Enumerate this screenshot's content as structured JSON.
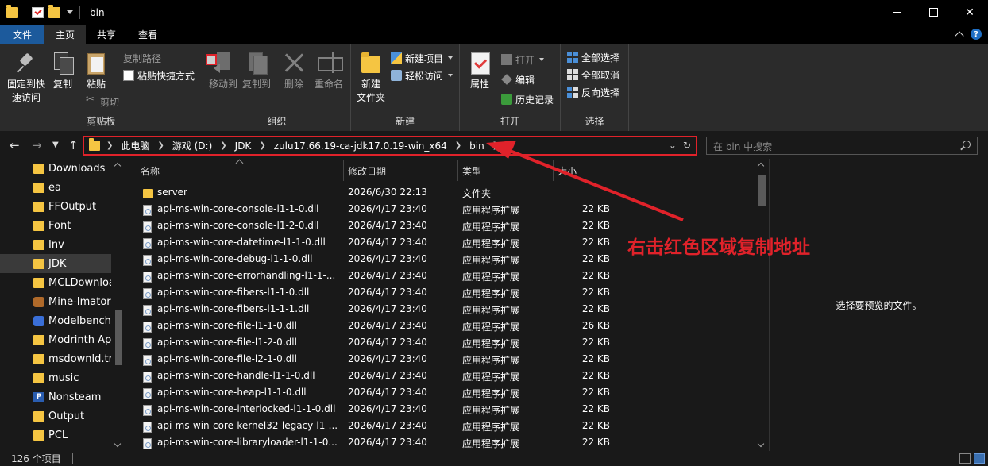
{
  "window": {
    "title": "bin",
    "controls": [
      "minimize",
      "maximize",
      "close"
    ]
  },
  "tabs": [
    {
      "label": "文件",
      "kind": "file"
    },
    {
      "label": "主页",
      "kind": "active"
    },
    {
      "label": "共享",
      "kind": "normal"
    },
    {
      "label": "查看",
      "kind": "normal"
    }
  ],
  "ribbon": {
    "clipboard": {
      "label": "剪贴板",
      "pin": "固定到快\n速访问",
      "copy": "复制",
      "paste": "粘贴",
      "copy_path": "复制路径",
      "paste_shortcut": "粘贴快捷方式",
      "cut": "剪切"
    },
    "organize": {
      "label": "组织",
      "move_to": "移动到",
      "copy_to": "复制到",
      "delete": "删除",
      "rename": "重命名"
    },
    "new": {
      "label": "新建",
      "new_item": "新建项目",
      "easy_access": "轻松访问",
      "new_folder": "新建\n文件夹"
    },
    "open": {
      "label": "打开",
      "properties": "属性",
      "open": "打开",
      "edit": "编辑",
      "history": "历史记录"
    },
    "select": {
      "label": "选择",
      "select_all": "全部选择",
      "select_none": "全部取消",
      "invert": "反向选择"
    }
  },
  "address": {
    "crumbs": [
      "此电脑",
      "游戏 (D:)",
      "JDK",
      "zulu17.66.19-ca-jdk17.0.19-win_x64",
      "bin"
    ],
    "search_placeholder": "在 bin 中搜索"
  },
  "sidebar": {
    "items": [
      {
        "label": "Downloads",
        "icon": "folder"
      },
      {
        "label": "ea",
        "icon": "folder"
      },
      {
        "label": "FFOutput",
        "icon": "folder"
      },
      {
        "label": "Font",
        "icon": "folder"
      },
      {
        "label": "Inv",
        "icon": "folder"
      },
      {
        "label": "JDK",
        "icon": "folder",
        "selected": true
      },
      {
        "label": "MCLDownloa",
        "icon": "folder"
      },
      {
        "label": "Mine-Imator",
        "icon": "app"
      },
      {
        "label": "Modelbench",
        "icon": "app"
      },
      {
        "label": "Modrinth App",
        "icon": "folder"
      },
      {
        "label": "msdownld.tm",
        "icon": "folder"
      },
      {
        "label": "music",
        "icon": "folder"
      },
      {
        "label": "Nonsteam",
        "icon": "nonsteam"
      },
      {
        "label": "Output",
        "icon": "folder"
      },
      {
        "label": "PCL",
        "icon": "folder"
      }
    ]
  },
  "filelist": {
    "columns": {
      "name": "名称",
      "date": "修改日期",
      "type": "类型",
      "size": "大小"
    },
    "rows": [
      {
        "name": "server",
        "date": "2026/6/30 22:13",
        "type": "文件夹",
        "size": "",
        "icon": "folder"
      },
      {
        "name": "api-ms-win-core-console-l1-1-0.dll",
        "date": "2026/4/17 23:40",
        "type": "应用程序扩展",
        "size": "22 KB",
        "icon": "dll"
      },
      {
        "name": "api-ms-win-core-console-l1-2-0.dll",
        "date": "2026/4/17 23:40",
        "type": "应用程序扩展",
        "size": "22 KB",
        "icon": "dll"
      },
      {
        "name": "api-ms-win-core-datetime-l1-1-0.dll",
        "date": "2026/4/17 23:40",
        "type": "应用程序扩展",
        "size": "22 KB",
        "icon": "dll"
      },
      {
        "name": "api-ms-win-core-debug-l1-1-0.dll",
        "date": "2026/4/17 23:40",
        "type": "应用程序扩展",
        "size": "22 KB",
        "icon": "dll"
      },
      {
        "name": "api-ms-win-core-errorhandling-l1-1-...",
        "date": "2026/4/17 23:40",
        "type": "应用程序扩展",
        "size": "22 KB",
        "icon": "dll"
      },
      {
        "name": "api-ms-win-core-fibers-l1-1-0.dll",
        "date": "2026/4/17 23:40",
        "type": "应用程序扩展",
        "size": "22 KB",
        "icon": "dll"
      },
      {
        "name": "api-ms-win-core-fibers-l1-1-1.dll",
        "date": "2026/4/17 23:40",
        "type": "应用程序扩展",
        "size": "22 KB",
        "icon": "dll"
      },
      {
        "name": "api-ms-win-core-file-l1-1-0.dll",
        "date": "2026/4/17 23:40",
        "type": "应用程序扩展",
        "size": "26 KB",
        "icon": "dll"
      },
      {
        "name": "api-ms-win-core-file-l1-2-0.dll",
        "date": "2026/4/17 23:40",
        "type": "应用程序扩展",
        "size": "22 KB",
        "icon": "dll"
      },
      {
        "name": "api-ms-win-core-file-l2-1-0.dll",
        "date": "2026/4/17 23:40",
        "type": "应用程序扩展",
        "size": "22 KB",
        "icon": "dll"
      },
      {
        "name": "api-ms-win-core-handle-l1-1-0.dll",
        "date": "2026/4/17 23:40",
        "type": "应用程序扩展",
        "size": "22 KB",
        "icon": "dll"
      },
      {
        "name": "api-ms-win-core-heap-l1-1-0.dll",
        "date": "2026/4/17 23:40",
        "type": "应用程序扩展",
        "size": "22 KB",
        "icon": "dll"
      },
      {
        "name": "api-ms-win-core-interlocked-l1-1-0.dll",
        "date": "2026/4/17 23:40",
        "type": "应用程序扩展",
        "size": "22 KB",
        "icon": "dll"
      },
      {
        "name": "api-ms-win-core-kernel32-legacy-l1-...",
        "date": "2026/4/17 23:40",
        "type": "应用程序扩展",
        "size": "22 KB",
        "icon": "dll"
      },
      {
        "name": "api-ms-win-core-libraryloader-l1-1-0....",
        "date": "2026/4/17 23:40",
        "type": "应用程序扩展",
        "size": "22 KB",
        "icon": "dll"
      }
    ]
  },
  "preview": {
    "text": "选择要预览的文件。"
  },
  "status": {
    "count": "126 个项目"
  },
  "annotation": {
    "text": "右击红色区域复制地址",
    "color": "#e0222a"
  }
}
